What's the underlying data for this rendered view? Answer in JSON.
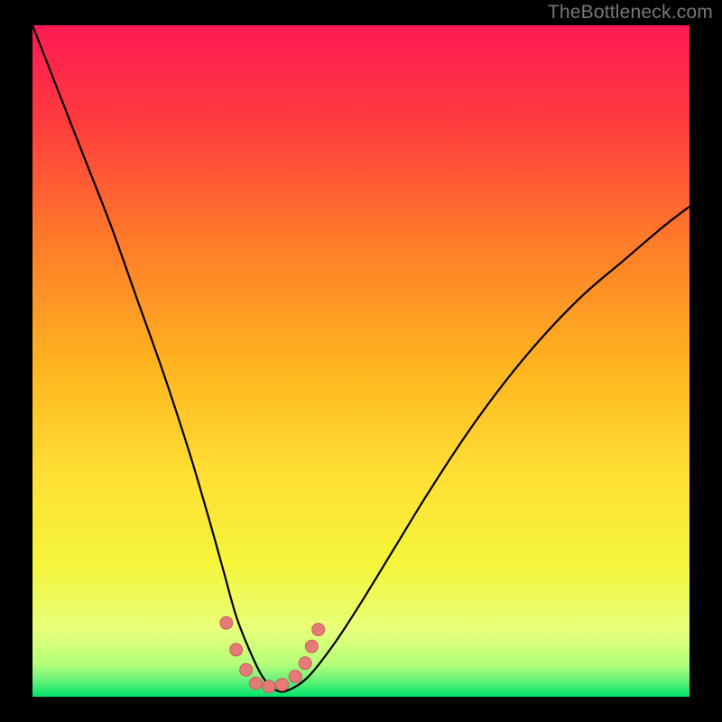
{
  "watermark": "TheBottleneck.com",
  "chart_data": {
    "type": "line",
    "title": "",
    "xlabel": "",
    "ylabel": "",
    "xlim": [
      0,
      100
    ],
    "ylim": [
      0,
      100
    ],
    "grid": false,
    "legend": false,
    "background_gradient": {
      "top_color": "#ff1a54",
      "mid_color": "#ffdd33",
      "bottom_near_color": "#e8ff7a",
      "bottom_color": "#00e46a"
    },
    "series": [
      {
        "name": "bottleneck-curve",
        "stroke": "#000000",
        "x": [
          0,
          4,
          8,
          12,
          16,
          20,
          24,
          27,
          29,
          31,
          33,
          35,
          37,
          39,
          42,
          46,
          50,
          55,
          60,
          66,
          72,
          78,
          84,
          90,
          96,
          100
        ],
        "y": [
          100,
          90,
          80,
          70,
          59,
          48,
          36,
          26,
          19,
          12,
          7,
          3,
          1,
          1,
          3,
          8,
          14,
          22,
          30,
          39,
          47,
          54,
          60,
          65,
          70,
          73
        ]
      }
    ],
    "markers": {
      "name": "curve-dots",
      "fill": "#e67a78",
      "stroke": "#c95f5d",
      "x": [
        29.5,
        31.0,
        32.5,
        34.0,
        36.0,
        38.0,
        40.0,
        41.5,
        42.5,
        43.5
      ],
      "y": [
        11.0,
        7.0,
        4.0,
        2.0,
        1.5,
        1.8,
        3.0,
        5.0,
        7.5,
        10.0
      ]
    }
  }
}
